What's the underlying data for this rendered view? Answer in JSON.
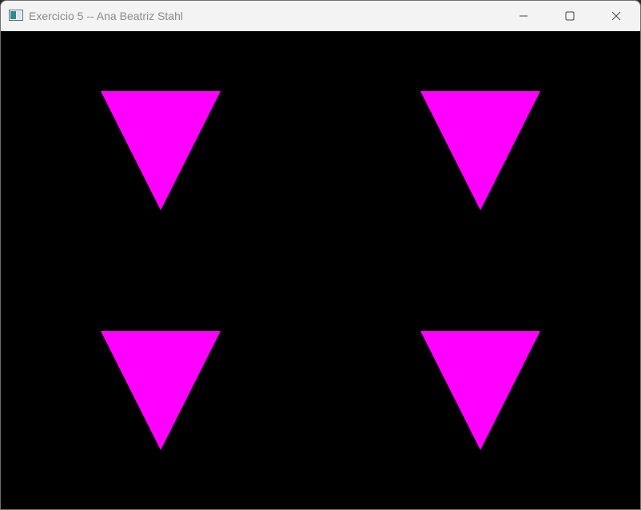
{
  "window": {
    "title": "Exercicio 5 -- Ana Beatriz Stahl",
    "controls": [
      "minimize-icon",
      "maximize-icon",
      "close-icon"
    ]
  },
  "canvas": {
    "background": "#000000",
    "shape_color": "#ff00ff",
    "shapes": [
      "downward-triangle",
      "downward-triangle",
      "downward-triangle",
      "downward-triangle"
    ]
  }
}
